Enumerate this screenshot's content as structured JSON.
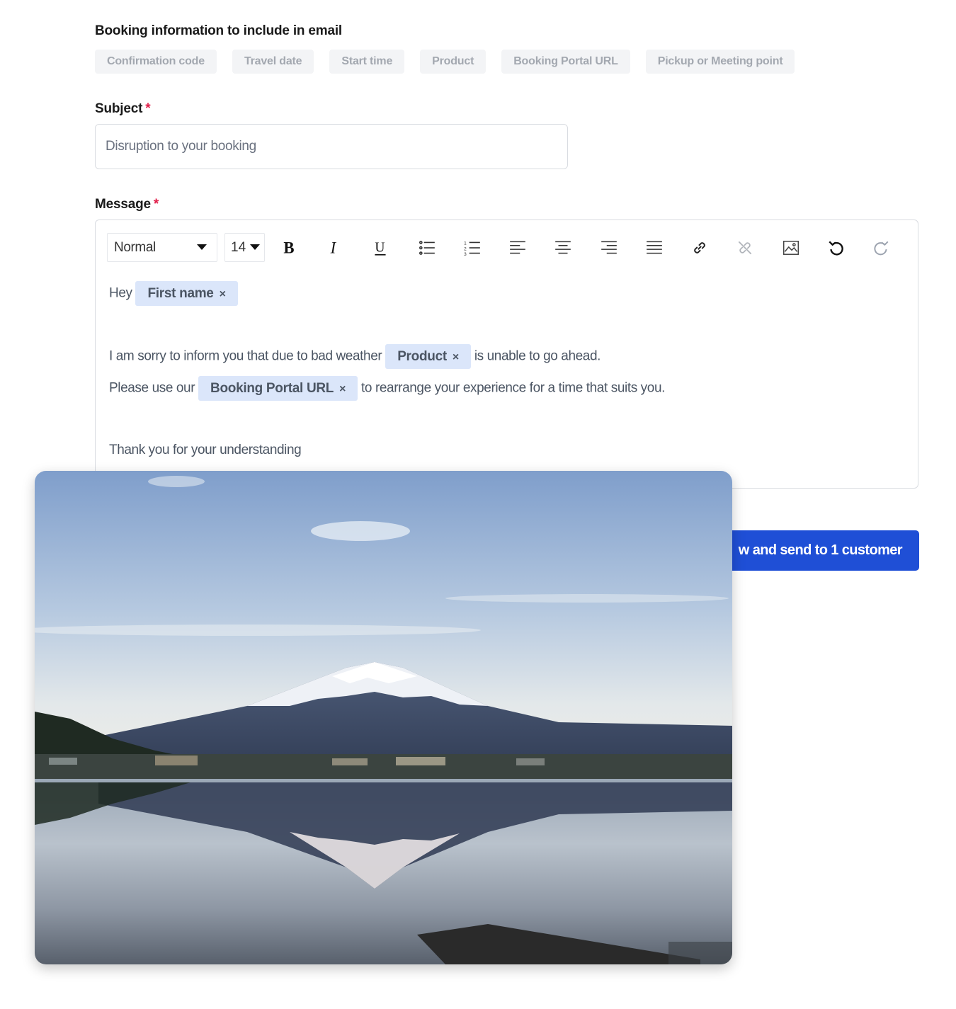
{
  "booking_info": {
    "heading": "Booking information to include in email",
    "chips": [
      "Confirmation code",
      "Travel date",
      "Start time",
      "Product",
      "Booking Portal URL",
      "Pickup or Meeting point"
    ]
  },
  "subject": {
    "label": "Subject",
    "required_mark": "*",
    "value": "Disruption to your booking"
  },
  "message": {
    "label": "Message",
    "required_mark": "*",
    "toolbar": {
      "style_value": "Normal",
      "size_value": "14",
      "icons": [
        "bold-icon",
        "italic-icon",
        "underline-icon",
        "bullet-list-icon",
        "numbered-list-icon",
        "align-left-icon",
        "align-center-icon",
        "align-right-icon",
        "align-justify-icon",
        "link-icon",
        "unlink-icon",
        "image-icon",
        "undo-icon",
        "redo-icon"
      ]
    },
    "line1": {
      "before": "Hey",
      "tag": "First name"
    },
    "line2": {
      "before": "I am sorry to inform you that due to bad weather",
      "tag": "Product",
      "after": "is unable to go ahead."
    },
    "line3": {
      "before": "Please use our",
      "tag": "Booking Portal URL",
      "after": "to rearrange your experience for a time that suits you."
    },
    "line4": "Thank you for your understanding",
    "tag_remove_glyph": "×"
  },
  "send_button": {
    "label": "w and send to 1 customer"
  },
  "colors": {
    "primary": "#1f4fd6",
    "tag_bg": "#dbe6fa",
    "required": "#e11d48"
  }
}
